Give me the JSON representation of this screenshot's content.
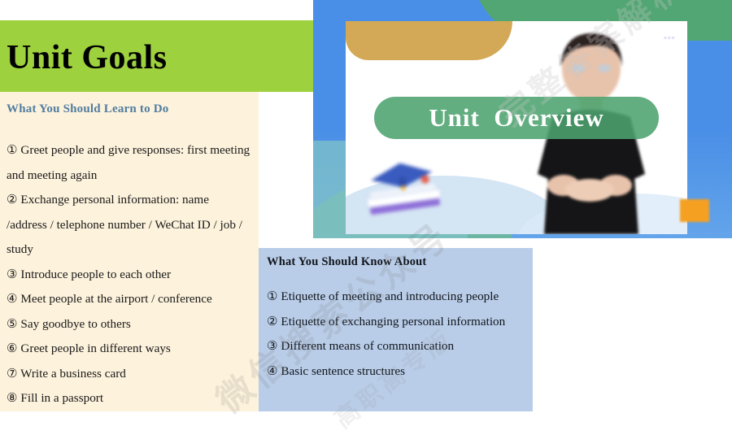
{
  "slide": {
    "title": "Unit Goals",
    "learn_section": {
      "heading": "What You Should Learn to Do",
      "items": [
        "① Greet people and give responses: first meeting and meeting again",
        "② Exchange personal information: name /address / telephone number / WeChat ID / job / study",
        "③ Introduce people to each other",
        "④ Meet people at the airport / conference",
        "⑤ Say goodbye to others",
        "⑥ Greet people in different ways",
        "⑦ Write a business card",
        "⑧ Fill in a passport"
      ]
    },
    "know_section": {
      "heading": "What You Should Know About",
      "items": [
        "① Etiquette of meeting and introducing people",
        "② Etiquette of exchanging personal information",
        "③ Different means of communication",
        "④ Basic sentence structures"
      ]
    }
  },
  "video": {
    "banner_label": "Unit  Overview",
    "logo_mark": "▪▪▪",
    "icons": {
      "books": "books-graduation-cap-illustration",
      "person": "presenter-figure"
    }
  },
  "watermark": {
    "line_a": "微信搜索公众号",
    "line_b": "完整答案解析",
    "line_c": "高职高专版"
  },
  "colors": {
    "band_green": "#9ed13e",
    "cream_panel": "#fdf2dc",
    "blue_panel": "#b9cde8",
    "heading_blue": "#517da0",
    "banner_green": "#4ca36e",
    "video_blue": "#4a8fe7",
    "tan": "#d3a957",
    "orange": "#f5a021"
  }
}
